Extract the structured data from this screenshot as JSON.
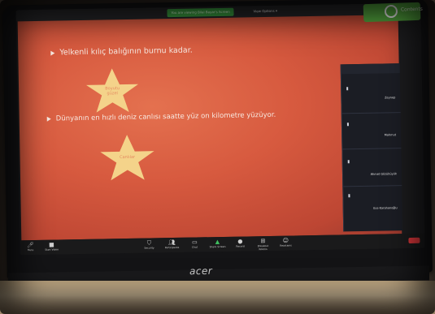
{
  "zoom": {
    "share_pill": "You are viewing Bilal Bayar's Screen",
    "view_options": "View Options ▾",
    "corner_tag": "Contents"
  },
  "slide": {
    "bullet1": "Yelkenli kılıç balığının burnu kadar.",
    "bullet2": "Dünyanın en hızlı deniz canlısı saatte yüz on kilometre yüzüyor.",
    "star1": "Boyutu\ngüzel",
    "star2": "Canlılar"
  },
  "participants": [
    {
      "name": "Zeynep"
    },
    {
      "name": "Mahmut"
    },
    {
      "name": "Ahmet Gözübüyük"
    },
    {
      "name": "Ece Karahanoğlu"
    }
  ],
  "toolbar": {
    "items": [
      {
        "icon": "mic-icon",
        "label": "Mute"
      },
      {
        "icon": "video-icon",
        "label": "Start Video"
      },
      {
        "icon": "security-icon",
        "label": "Security"
      },
      {
        "icon": "participants-icon",
        "label": "Participants"
      },
      {
        "icon": "chat-icon",
        "label": "Chat"
      },
      {
        "icon": "share-icon",
        "label": "Share Screen"
      },
      {
        "icon": "record-icon",
        "label": "Record"
      },
      {
        "icon": "breakout-icon",
        "label": "Breakout Rooms"
      },
      {
        "icon": "reactions-icon",
        "label": "Reactions"
      }
    ],
    "end_color": "#d8363a"
  },
  "laptop": {
    "brand": "acer"
  },
  "colors": {
    "slide_bg": "#d75a3f",
    "zoom_green": "#3a9b40",
    "star": "#f4d38a"
  }
}
